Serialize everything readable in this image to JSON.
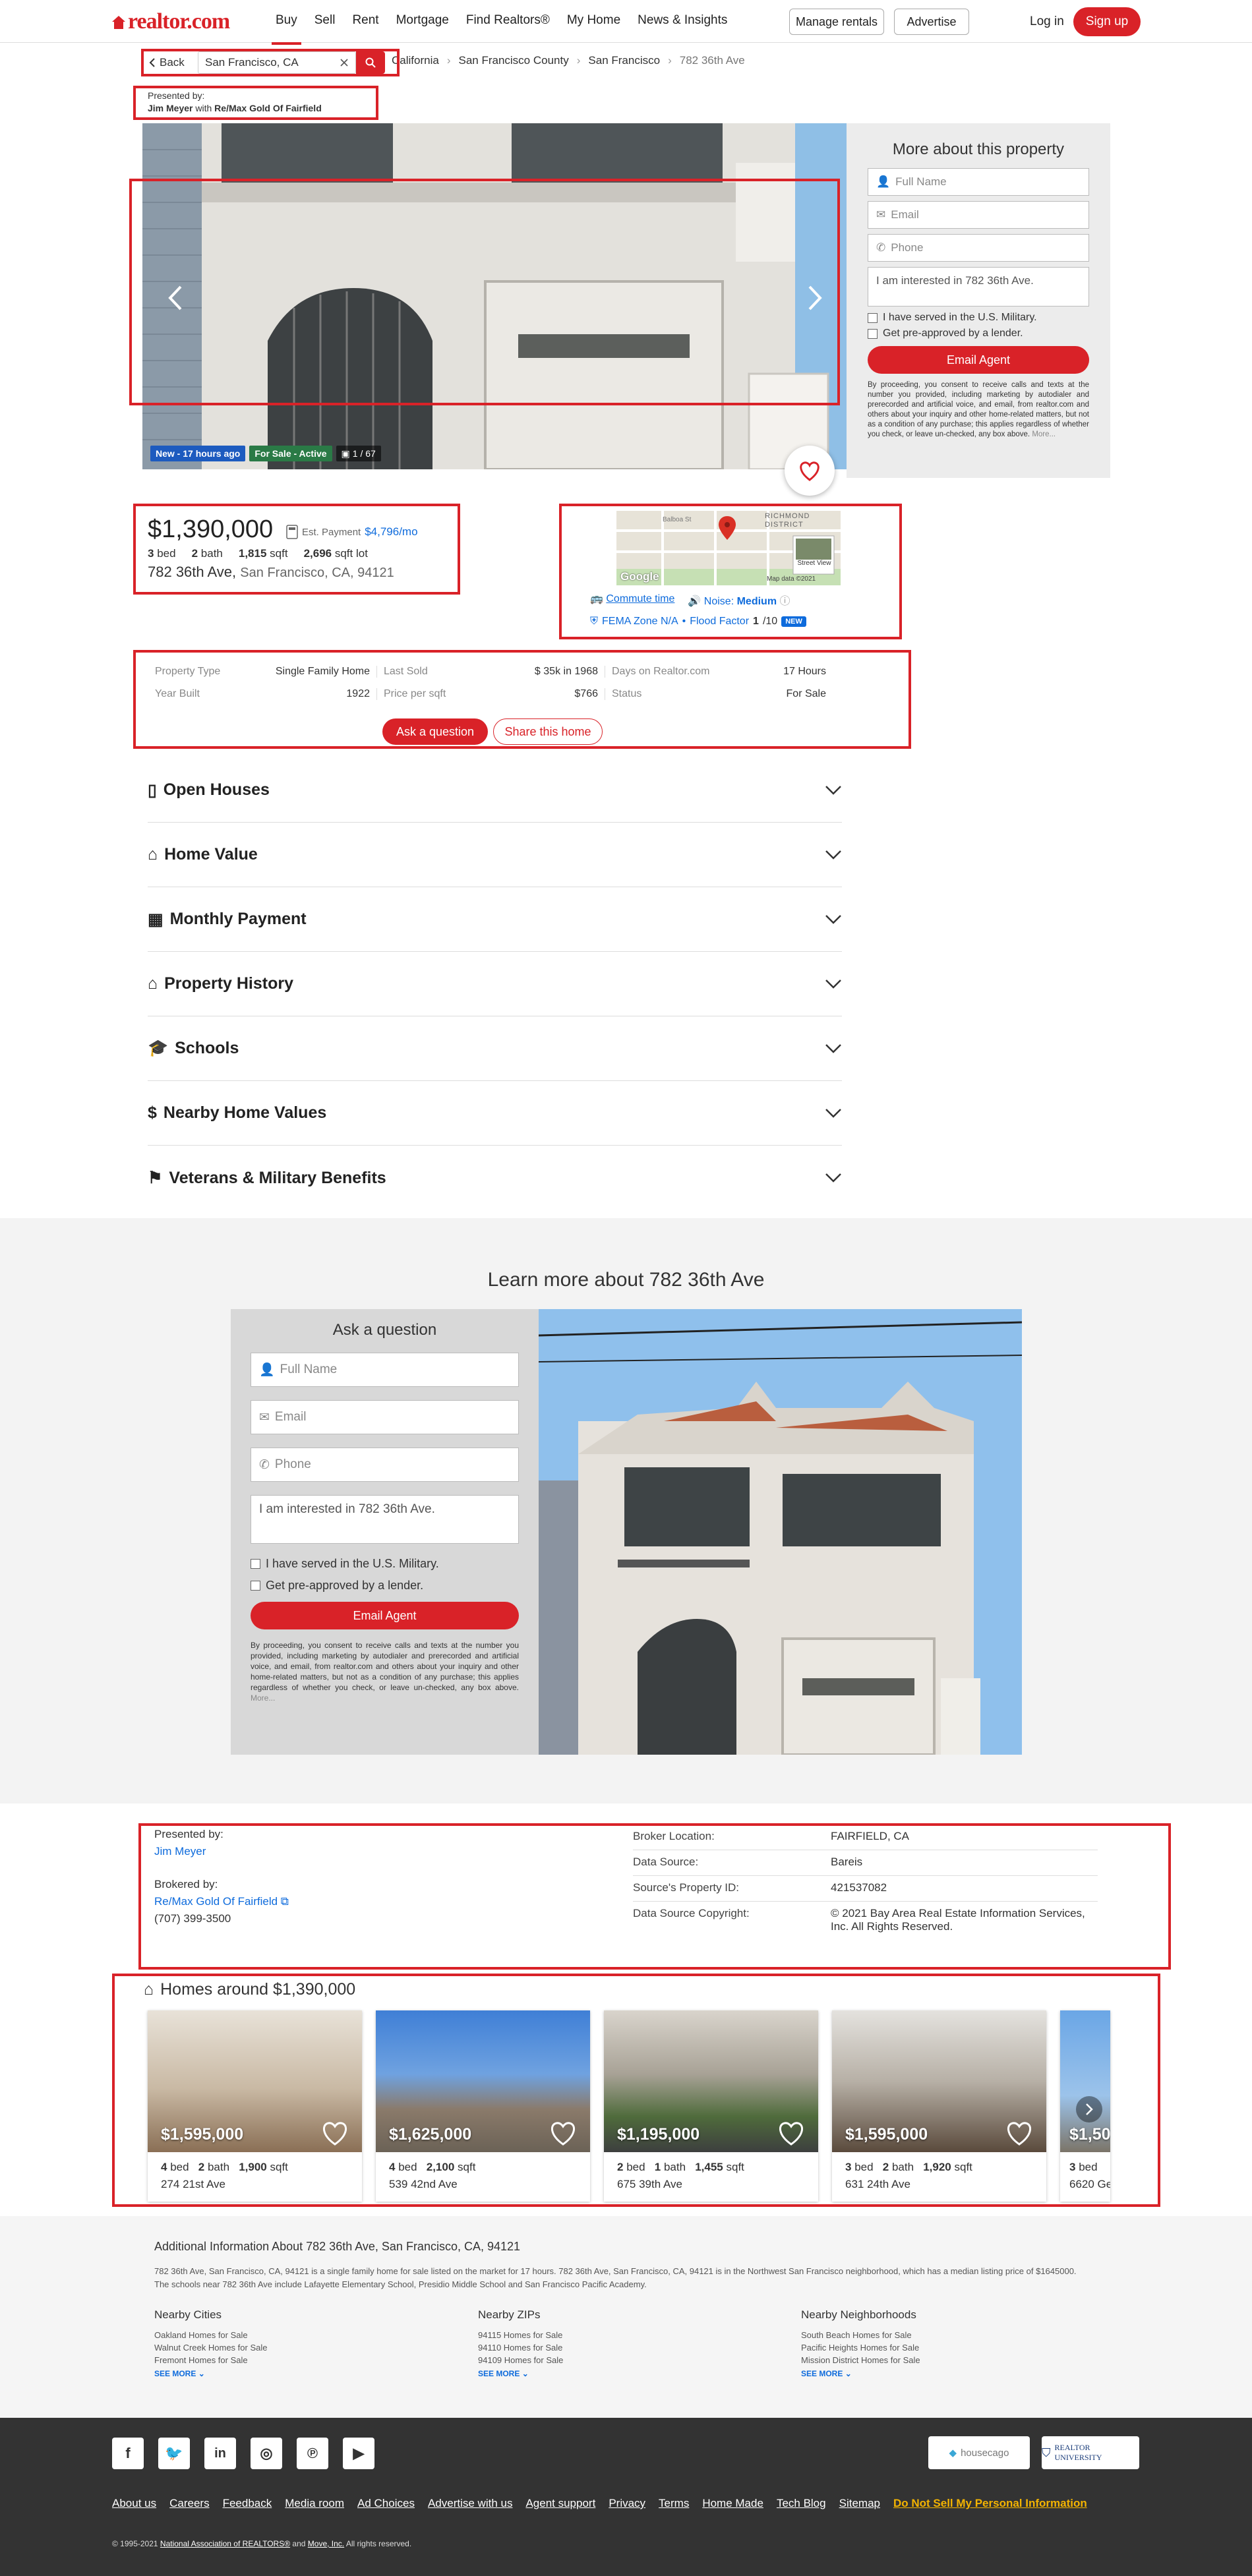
{
  "header": {
    "logo": "realtor.com",
    "nav": [
      "Buy",
      "Sell",
      "Rent",
      "Mortgage",
      "Find Realtors®",
      "My Home",
      "News & Insights"
    ],
    "manage_rentals": "Manage rentals",
    "advertise": "Advertise",
    "login": "Log in",
    "signup": "Sign up"
  },
  "search": {
    "back": "Back",
    "value": "San Francisco, CA"
  },
  "breadcrumbs": [
    "California",
    "San Francisco County",
    "San Francisco",
    "782 36th Ave"
  ],
  "presented": {
    "label": "Presented by:",
    "agent": "Jim Meyer",
    "with": "with",
    "brokerage": "Re/Max Gold Of Fairfield"
  },
  "gallery": {
    "badge_new": "New - 17 hours ago",
    "badge_status": "For Sale - Active",
    "photo_count": "1 / 67"
  },
  "side_form": {
    "title": "More about this property",
    "name_placeholder": "Full Name",
    "email_placeholder": "Email",
    "phone_placeholder": "Phone",
    "message": "I am interested in 782 36th Ave.",
    "military": "I have served in the U.S. Military.",
    "preapproved": "Get pre-approved by a lender.",
    "submit": "Email Agent",
    "disclaimer": "By proceeding, you consent to receive calls and texts at the number you provided, including marketing by autodialer and prerecorded and artificial voice, and email, from realtor.com and others about your inquiry and other home-related matters, but not as a condition of any purchase; this applies regardless of whether you check, or leave un-checked, any box above.",
    "more": "More..."
  },
  "listing": {
    "price": "$1,390,000",
    "est_payment_label": "Est. Payment",
    "est_payment": "$4,796/mo",
    "beds": "3",
    "beds_label": "bed",
    "baths": "2",
    "baths_label": "bath",
    "sqft": "1,815",
    "sqft_label": "sqft",
    "lot": "2,696",
    "lot_label": "sqft lot",
    "street": "782 36th Ave,",
    "city": "San Francisco, CA, 94121"
  },
  "map": {
    "street_view": "Street View",
    "map_data": "Map data ©2021",
    "google": "Google",
    "district": "RICHMOND DISTRICT",
    "street1": "Balboa St",
    "commute": "Commute time",
    "noise_label": "Noise:",
    "noise_value": "Medium",
    "fema": "FEMA Zone N/A",
    "flood_label": "Flood Factor",
    "flood_value": "1",
    "flood_max": "/10",
    "new": "NEW"
  },
  "summary": {
    "rows": [
      [
        [
          "Property Type",
          "Single Family Home"
        ],
        [
          "Last Sold",
          "$ 35k in 1968"
        ],
        [
          "Days on Realtor.com",
          "17 Hours"
        ]
      ],
      [
        [
          "Year Built",
          "1922"
        ],
        [
          "Price per sqft",
          "$766"
        ],
        [
          "Status",
          "For Sale"
        ]
      ]
    ],
    "ask": "Ask a question",
    "share": "Share this home"
  },
  "accordion": [
    "Open Houses",
    "Home Value",
    "Monthly Payment",
    "Property History",
    "Schools",
    "Nearby Home Values",
    "Veterans & Military Benefits"
  ],
  "learn": {
    "title": "Learn more about 782 36th Ave",
    "form_title": "Ask a question"
  },
  "broker": {
    "presented_label": "Presented by:",
    "agent": "Jim Meyer",
    "brokered_label": "Brokered by:",
    "brokerage": "Re/Max Gold Of Fairfield",
    "phone": "(707) 399-3500",
    "table": [
      [
        "Broker Location:",
        "FAIRFIELD, CA"
      ],
      [
        "Data Source:",
        "Bareis"
      ],
      [
        "Source's Property ID:",
        "421537082"
      ],
      [
        "Data Source Copyright:",
        "© 2021 Bay Area Real Estate Information Services, Inc. All Rights Reserved."
      ]
    ]
  },
  "homes_around": {
    "title": "Homes around $1,390,000",
    "cards": [
      {
        "price": "$1,595,000",
        "beds": "4",
        "baths": "2",
        "sqft": "1,900",
        "address": "274 21st Ave"
      },
      {
        "price": "$1,625,000",
        "beds": "4",
        "baths": "",
        "sqft": "2,100",
        "address": "539 42nd Ave"
      },
      {
        "price": "$1,195,000",
        "beds": "2",
        "baths": "1",
        "sqft": "1,455",
        "address": "675 39th Ave"
      },
      {
        "price": "$1,595,000",
        "beds": "3",
        "baths": "2",
        "sqft": "1,920",
        "address": "631 24th Ave"
      },
      {
        "price": "$1,50",
        "beds": "3",
        "baths": "",
        "sqft": "",
        "address": "6620 Ge"
      }
    ],
    "labels": {
      "bed": "bed",
      "bath": "bath",
      "sqft": "sqft"
    }
  },
  "additional": {
    "title": "Additional Information About 782 36th Ave, San Francisco, CA, 94121",
    "text": "782 36th Ave, San Francisco, CA, 94121 is a single family home for sale listed on the market for 17 hours. 782 36th Ave, San Francisco, CA, 94121 is in the Northwest San Francisco neighborhood, which has a median listing price of $1645000. The schools near 782 36th Ave include Lafayette Elementary School, Presidio Middle School and San Francisco Pacific Academy.",
    "cols": [
      {
        "title": "Nearby Cities",
        "items": [
          "Oakland Homes for Sale",
          "Walnut Creek Homes for Sale",
          "Fremont Homes for Sale"
        ]
      },
      {
        "title": "Nearby ZIPs",
        "items": [
          "94115 Homes for Sale",
          "94110 Homes for Sale",
          "94109 Homes for Sale"
        ]
      },
      {
        "title": "Nearby Neighborhoods",
        "items": [
          "South Beach Homes for Sale",
          "Pacific Heights Homes for Sale",
          "Mission District Homes for Sale"
        ]
      }
    ],
    "see_more": "SEE MORE"
  },
  "footer": {
    "links": [
      "About us",
      "Careers",
      "Feedback",
      "Media room",
      "Ad Choices",
      "Advertise with us",
      "Agent support",
      "Privacy",
      "Terms",
      "Home Made",
      "Tech Blog",
      "Sitemap"
    ],
    "dns": "Do Not Sell My Personal Information",
    "copyright_pre": "© 1995-2021",
    "nar": "National Association of REALTORS®",
    "and": "and",
    "move": "Move, Inc.",
    "rights": "All rights reserved.",
    "housing": "housecago",
    "realtor_u": "REALTOR UNIVERSITY"
  },
  "colors": {
    "brand": "#d92228",
    "link": "#0e6bdc",
    "footer": "#333333"
  }
}
